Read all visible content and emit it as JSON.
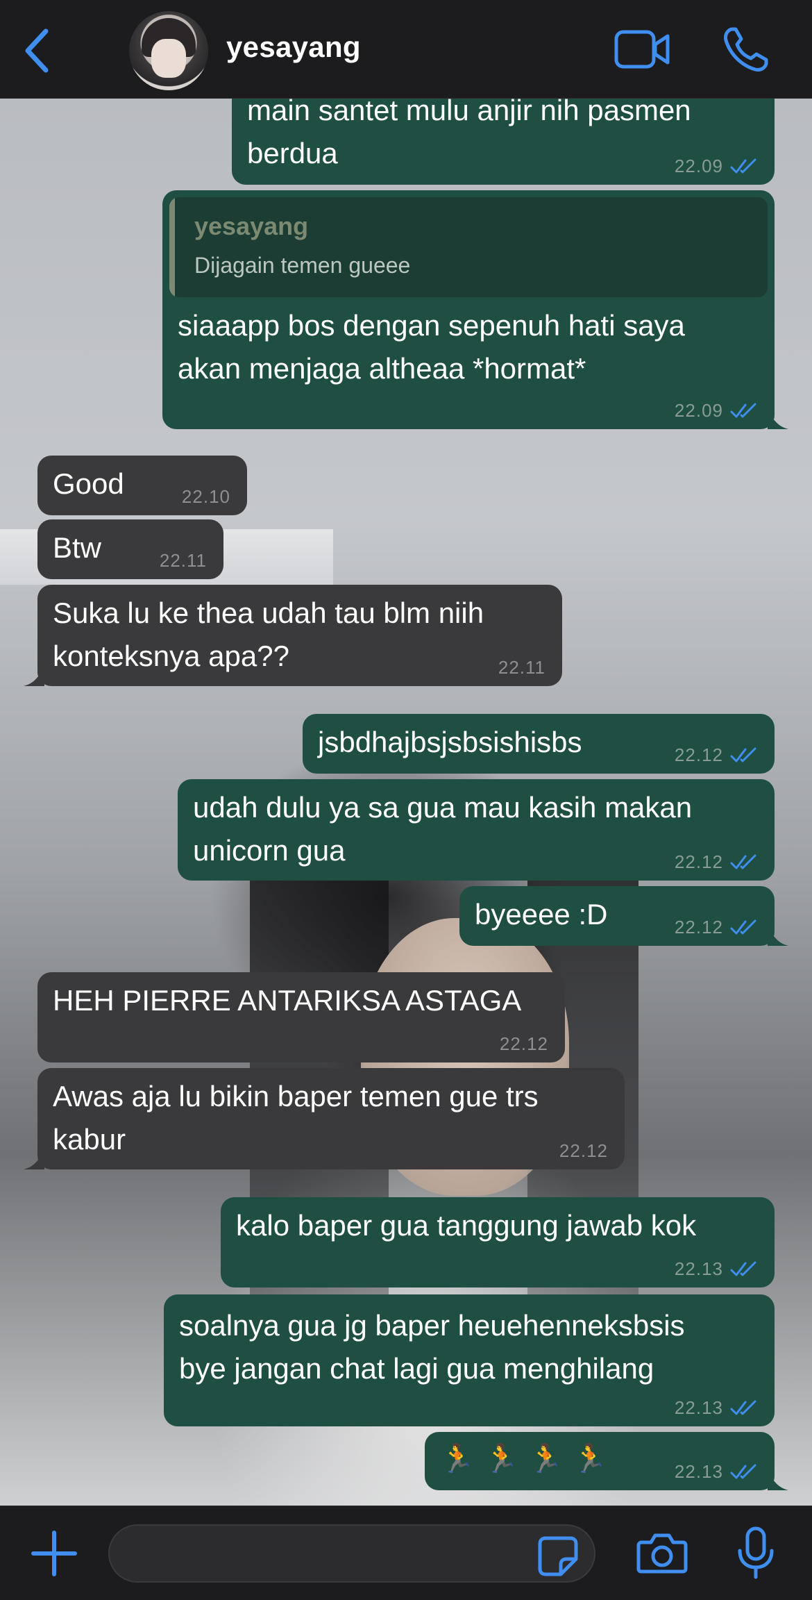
{
  "header": {
    "contact_name": "yesayang"
  },
  "reply_preview": {
    "name": "yesayang",
    "text": "Dijagain temen gueee"
  },
  "messages": [
    {
      "dir": "out",
      "text": "main santet mulu anjir nih pasmen\nberdua",
      "time": "22.09",
      "read": true
    },
    {
      "dir": "out",
      "text": "siaaapp bos dengan sepenuh hati saya\nakan menjaga altheaa *hormat*",
      "time": "22.09",
      "read": true
    },
    {
      "dir": "in",
      "text": "Good",
      "time": "22.10"
    },
    {
      "dir": "in",
      "text": "Btw",
      "time": "22.11"
    },
    {
      "dir": "in",
      "text": "Suka lu ke thea udah tau blm niih\nkonteksnya apa??",
      "time": "22.11"
    },
    {
      "dir": "out",
      "text": "jsbdhajbsjsbsishisbs",
      "time": "22.12",
      "read": true
    },
    {
      "dir": "out",
      "text": "udah dulu ya sa gua mau kasih makan\nunicorn gua",
      "time": "22.12",
      "read": true
    },
    {
      "dir": "out",
      "text": "byeeee :D",
      "time": "22.12",
      "read": true
    },
    {
      "dir": "in",
      "text": "HEH PIERRE ANTARIKSA ASTAGA",
      "time": "22.12"
    },
    {
      "dir": "in",
      "text": "Awas aja lu bikin baper temen gue trs\nkabur",
      "time": "22.12"
    },
    {
      "dir": "out",
      "text": "kalo baper gua tanggung jawab kok",
      "time": "22.13",
      "read": true
    },
    {
      "dir": "out",
      "text": "soalnya gua jg baper heuehenneksbsis\nbye jangan chat lagi gua menghilang",
      "time": "22.13",
      "read": true
    },
    {
      "dir": "out",
      "text": "🏃🏃🏃🏃",
      "time": "22.13",
      "read": true
    }
  ],
  "input": {
    "value": "",
    "placeholder": ""
  },
  "colors": {
    "outgoing_bubble": "#1f4f42",
    "incoming_bubble": "#3a3a3c",
    "accent": "#3f8ef0",
    "read_ticks": "#3f8ef0"
  },
  "icons": [
    "back-chevron-icon",
    "video-camera-icon",
    "phone-icon",
    "plus-icon",
    "sticker-icon",
    "camera-icon",
    "microphone-icon",
    "double-check-icon"
  ]
}
